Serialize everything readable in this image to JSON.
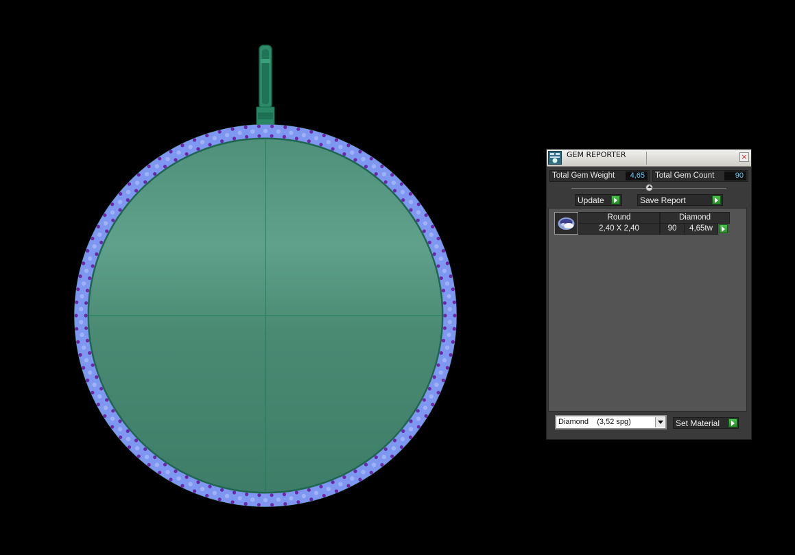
{
  "panel": {
    "title": "GEM REPORTER",
    "close_symbol": "×",
    "total_gem_weight_label": "Total Gem Weight",
    "total_gem_weight_value": "4,65",
    "total_gem_count_label": "Total Gem Count",
    "total_gem_count_value": "90",
    "update_label": "Update",
    "save_report_label": "Save Report",
    "set_material_label": "Set Material",
    "material_selected": "Diamond    (3,52 spg)",
    "gems": [
      {
        "shape": "Round",
        "material": "Diamond",
        "size": "2,40 X 2,40",
        "count": "90",
        "weight": "4,65tw"
      }
    ]
  },
  "colors": {
    "background": "#000000",
    "pendant_green": "#4f957c",
    "gem_blue": "#7e97f0",
    "prong_purple": "#6a2aa8",
    "accent_value": "#6fc7f0",
    "go_button": "#35a637"
  }
}
